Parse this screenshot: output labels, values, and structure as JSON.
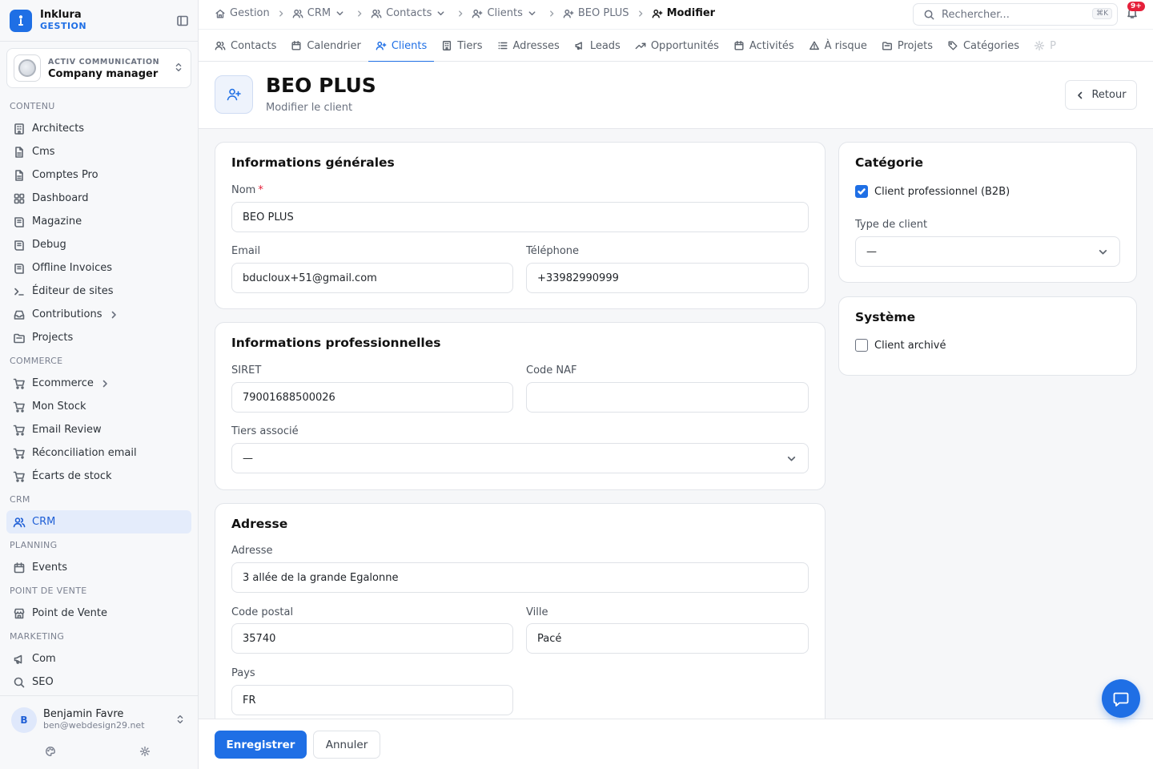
{
  "brand": {
    "name": "Inklura",
    "sub": "GESTION"
  },
  "company": {
    "kicker": "ACTIV COMMUNICATION",
    "name": "Company manager"
  },
  "sidebar": {
    "sections": [
      {
        "title": "CONTENU",
        "items": [
          {
            "label": "Architects",
            "icon": "building-icon"
          },
          {
            "label": "Cms",
            "icon": "file-icon"
          },
          {
            "label": "Comptes Pro",
            "icon": "file-icon"
          },
          {
            "label": "Dashboard",
            "icon": "grid-icon"
          },
          {
            "label": "Magazine",
            "icon": "book-icon"
          },
          {
            "label": "Debug",
            "icon": "book-icon"
          },
          {
            "label": "Offline Invoices",
            "icon": "book-icon"
          },
          {
            "label": "Éditeur de sites",
            "icon": "terminal-icon"
          },
          {
            "label": "Contributions",
            "icon": "inbox-icon",
            "expandable": true
          },
          {
            "label": "Projects",
            "icon": "folder-icon"
          }
        ]
      },
      {
        "title": "COMMERCE",
        "items": [
          {
            "label": "Ecommerce",
            "icon": "cart-icon",
            "expandable": true
          },
          {
            "label": "Mon Stock",
            "icon": "cart-icon"
          },
          {
            "label": "Email Review",
            "icon": "cart-icon"
          },
          {
            "label": "Réconciliation email",
            "icon": "cart-icon"
          },
          {
            "label": "Écarts de stock",
            "icon": "cart-icon"
          }
        ]
      },
      {
        "title": "CRM",
        "items": [
          {
            "label": "CRM",
            "icon": "users-icon",
            "active": true
          }
        ]
      },
      {
        "title": "PLANNING",
        "items": [
          {
            "label": "Events",
            "icon": "calendar-icon"
          }
        ]
      },
      {
        "title": "POINT DE VENTE",
        "items": [
          {
            "label": "Point de Vente",
            "icon": "store-icon"
          }
        ]
      },
      {
        "title": "MARKETING",
        "items": [
          {
            "label": "Com",
            "icon": "megaphone-icon"
          },
          {
            "label": "SEO",
            "icon": "search-icon"
          }
        ]
      }
    ]
  },
  "user": {
    "initial": "B",
    "name": "Benjamin Favre",
    "email": "ben@webdesign29.net"
  },
  "breadcrumbs": [
    {
      "label": "Gestion",
      "icon": "home-icon",
      "dropdown": false
    },
    {
      "label": "CRM",
      "icon": "users-icon",
      "dropdown": true
    },
    {
      "label": "Contacts",
      "icon": "users-icon",
      "dropdown": true
    },
    {
      "label": "Clients",
      "icon": "user-plus-icon",
      "dropdown": true
    },
    {
      "label": "BEO PLUS",
      "icon": "user-plus-icon",
      "dropdown": false
    },
    {
      "label": "Modifier",
      "icon": "user-plus-icon",
      "dropdown": false,
      "current": true
    }
  ],
  "search": {
    "placeholder": "Rechercher...",
    "shortcut": "⌘K"
  },
  "notifications": {
    "badge": "9+"
  },
  "tabs": [
    {
      "label": "Contacts",
      "icon": "users-icon"
    },
    {
      "label": "Calendrier",
      "icon": "calendar-icon"
    },
    {
      "label": "Clients",
      "icon": "user-plus-icon",
      "active": true
    },
    {
      "label": "Tiers",
      "icon": "building-icon"
    },
    {
      "label": "Adresses",
      "icon": "list-icon"
    },
    {
      "label": "Leads",
      "icon": "megaphone-icon"
    },
    {
      "label": "Opportunités",
      "icon": "trend-icon"
    },
    {
      "label": "Activités",
      "icon": "calendar-icon"
    },
    {
      "label": "À risque",
      "icon": "alert-icon"
    },
    {
      "label": "Projets",
      "icon": "folder-icon"
    },
    {
      "label": "Catégories",
      "icon": "tag-icon"
    },
    {
      "label": "P",
      "icon": "gear-icon",
      "faded": true
    }
  ],
  "page": {
    "title": "BEO PLUS",
    "subtitle": "Modifier le client",
    "back_label": "Retour"
  },
  "general": {
    "title": "Informations générales",
    "nom_label": "Nom",
    "required_mark": "*",
    "nom_value": "BEO PLUS",
    "email_label": "Email",
    "email_value": "bducloux+51@gmail.com",
    "phone_label": "Téléphone",
    "phone_value": "+33982990999"
  },
  "professional": {
    "title": "Informations professionnelles",
    "siret_label": "SIRET",
    "siret_value": "79001688500026",
    "naf_label": "Code NAF",
    "naf_value": "",
    "tiers_label": "Tiers associé",
    "tiers_value": "—"
  },
  "address": {
    "title": "Adresse",
    "address_label": "Adresse",
    "address_value": "3 allée de la grande Egalonne",
    "zip_label": "Code postal",
    "zip_value": "35740",
    "city_label": "Ville",
    "city_value": "Pacé",
    "country_label": "Pays",
    "country_value": "FR"
  },
  "category": {
    "title": "Catégorie",
    "b2b_label": "Client professionnel (B2B)",
    "b2b_checked": true,
    "type_label": "Type de client",
    "type_value": "—"
  },
  "system": {
    "title": "Système",
    "archived_label": "Client archivé",
    "archived_checked": false
  },
  "actions": {
    "save_label": "Enregistrer",
    "cancel_label": "Annuler"
  },
  "colors": {
    "accent": "#1f6fe5",
    "badge": "#e5203a",
    "active_bg": "#e4ecfb"
  }
}
